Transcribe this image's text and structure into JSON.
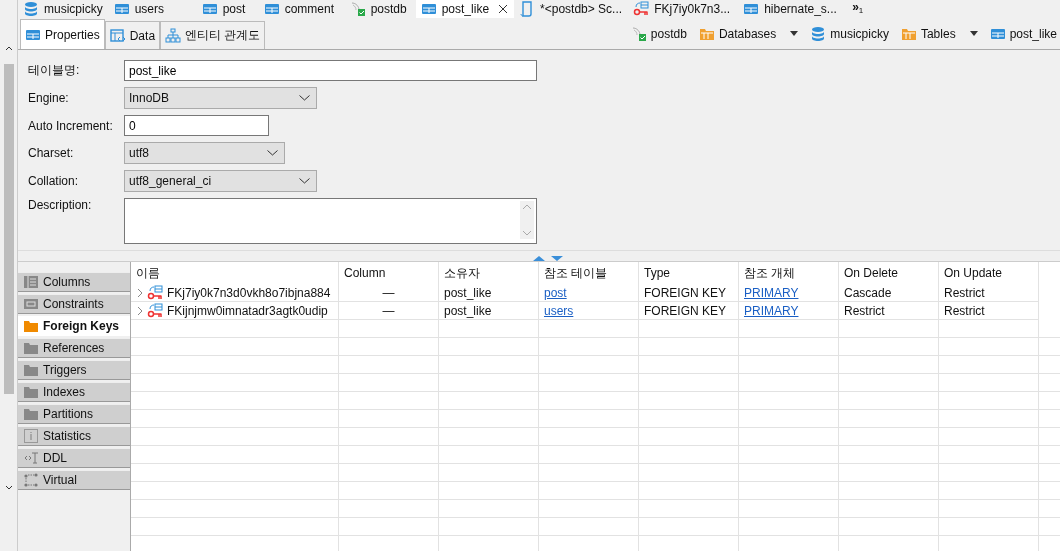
{
  "editor_tabs": [
    {
      "label": "musicpicky",
      "kind": "database",
      "selected": false,
      "closable": false
    },
    {
      "label": "users",
      "kind": "table",
      "selected": false,
      "closable": false
    },
    {
      "label": "post",
      "kind": "table",
      "selected": false,
      "closable": false
    },
    {
      "label": "comment",
      "kind": "table",
      "selected": false,
      "closable": false
    },
    {
      "label": "postdb",
      "kind": "connection",
      "selected": false,
      "closable": false
    },
    {
      "label": "post_like",
      "kind": "table",
      "selected": true,
      "closable": true
    },
    {
      "label": "*<postdb> Sc...",
      "kind": "script",
      "selected": false,
      "closable": false
    },
    {
      "label": "FKj7iy0k7n3...",
      "kind": "foreign-key",
      "selected": false,
      "closable": false
    },
    {
      "label": "hibernate_s...",
      "kind": "table",
      "selected": false,
      "closable": false
    }
  ],
  "overflow": {
    "label": "»",
    "count": "1"
  },
  "sub_tabs": [
    {
      "label": "Properties",
      "kind": "table",
      "selected": true
    },
    {
      "label": "Data",
      "kind": "data",
      "selected": false
    },
    {
      "label": "엔티티 관계도",
      "kind": "diagram",
      "selected": false
    }
  ],
  "breadcrumb": [
    {
      "label": "postdb",
      "kind": "connection",
      "dropdown": false
    },
    {
      "label": "Databases",
      "kind": "folder",
      "dropdown": true
    },
    {
      "label": "musicpicky",
      "kind": "database",
      "dropdown": false
    },
    {
      "label": "Tables",
      "kind": "folder",
      "dropdown": true
    },
    {
      "label": "post_like",
      "kind": "table",
      "dropdown": false
    }
  ],
  "form": [
    {
      "label": "테이블명:",
      "kind": "text",
      "value": "post_like"
    },
    {
      "label": "Engine:",
      "kind": "select",
      "value": "InnoDB"
    },
    {
      "label": "Auto Increment:",
      "kind": "text",
      "value": "0"
    },
    {
      "label": "Charset:",
      "kind": "select",
      "value": "utf8"
    },
    {
      "label": "Collation:",
      "kind": "select",
      "value": "utf8_general_ci"
    },
    {
      "label": "Description:",
      "kind": "textarea"
    }
  ],
  "side_tabs": [
    {
      "label": "Columns",
      "kind": "columns",
      "selected": false
    },
    {
      "label": "Constraints",
      "kind": "constraints",
      "selected": false
    },
    {
      "label": "Foreign Keys",
      "kind": "folder",
      "selected": true
    },
    {
      "label": "References",
      "kind": "folder",
      "selected": false
    },
    {
      "label": "Triggers",
      "kind": "folder",
      "selected": false
    },
    {
      "label": "Indexes",
      "kind": "folder",
      "selected": false
    },
    {
      "label": "Partitions",
      "kind": "folder",
      "selected": false
    },
    {
      "label": "Statistics",
      "kind": "info",
      "selected": false
    },
    {
      "label": "DDL",
      "kind": "ddl",
      "selected": false
    },
    {
      "label": "Virtual",
      "kind": "virtual",
      "selected": false
    }
  ],
  "table": {
    "columns": [
      "이름",
      "Column",
      "소유자",
      "참조 테이블",
      "Type",
      "참조 개체",
      "On Delete",
      "On Update"
    ],
    "rows": [
      {
        "cells": [
          "FKj7iy0k7n3d0vkh8o7ibjna884",
          "—",
          "post_like",
          "post",
          "FOREIGN KEY",
          "PRIMARY",
          "Cascade",
          "Restrict"
        ],
        "expanded": false
      },
      {
        "cells": [
          "FKijnjmw0imnatadr3agtk0udip",
          "—",
          "post_like",
          "users",
          "FOREIGN KEY",
          "PRIMARY",
          "Restrict",
          "Restrict"
        ],
        "expanded": false
      }
    ]
  }
}
